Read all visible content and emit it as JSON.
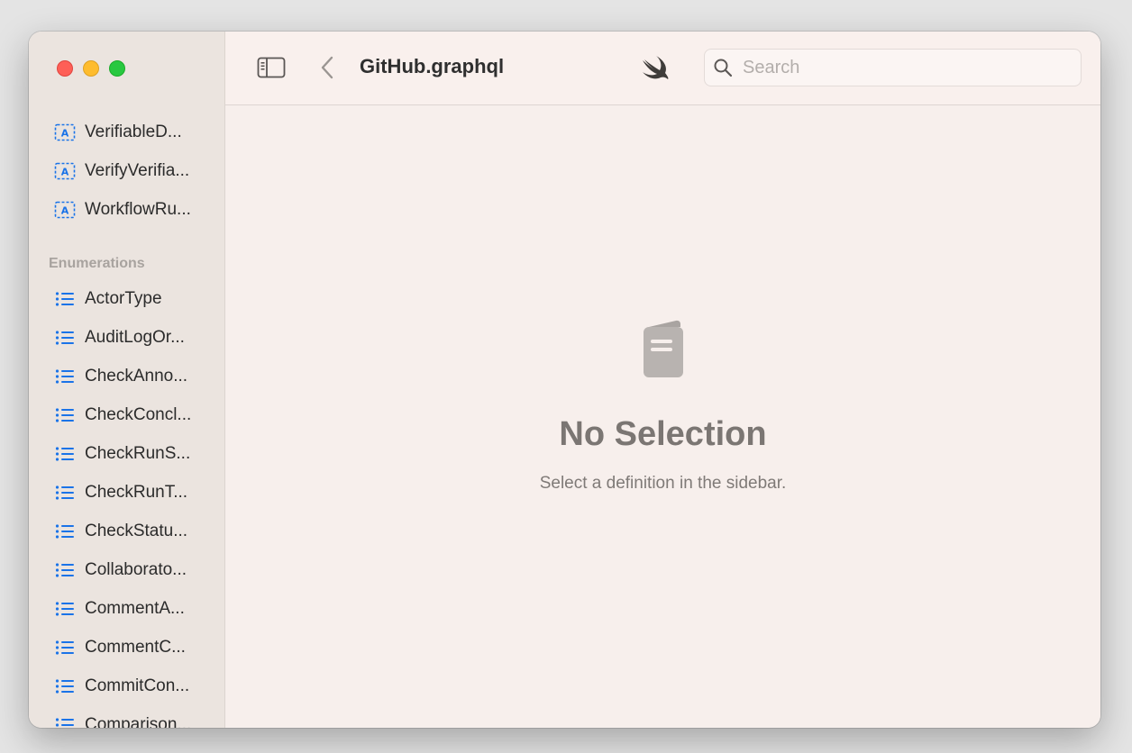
{
  "window": {
    "title": "GitHub.graphql"
  },
  "toolbar": {
    "title": "GitHub.graphql",
    "sidebar_toggle_icon": "sidebar-left-icon",
    "back_icon": "chevron-left-icon",
    "swift_icon": "swift-logo-icon"
  },
  "search": {
    "placeholder": "Search",
    "value": ""
  },
  "sidebar": {
    "top_items": [
      {
        "label": "VerifiableD...",
        "icon": "input-object-icon"
      },
      {
        "label": "VerifyVerifia...",
        "icon": "input-object-icon"
      },
      {
        "label": "WorkflowRu...",
        "icon": "input-object-icon"
      }
    ],
    "enumerations_header": "Enumerations",
    "enumerations": [
      {
        "label": "ActorType",
        "icon": "list-icon"
      },
      {
        "label": "AuditLogOr...",
        "icon": "list-icon"
      },
      {
        "label": "CheckAnno...",
        "icon": "list-icon"
      },
      {
        "label": "CheckConcl...",
        "icon": "list-icon"
      },
      {
        "label": "CheckRunS...",
        "icon": "list-icon"
      },
      {
        "label": "CheckRunT...",
        "icon": "list-icon"
      },
      {
        "label": "CheckStatu...",
        "icon": "list-icon"
      },
      {
        "label": "Collaborato...",
        "icon": "list-icon"
      },
      {
        "label": "CommentA...",
        "icon": "list-icon"
      },
      {
        "label": "CommentC...",
        "icon": "list-icon"
      },
      {
        "label": "CommitCon...",
        "icon": "list-icon"
      },
      {
        "label": "Comparison...",
        "icon": "list-icon"
      }
    ]
  },
  "empty_state": {
    "icon": "document-icon",
    "heading": "No Selection",
    "message": "Select a definition in the sidebar."
  },
  "colors": {
    "accent": "#1a73e8",
    "traffic_red": "#fe5f57",
    "traffic_yellow": "#febc2e",
    "traffic_green": "#28c840"
  }
}
